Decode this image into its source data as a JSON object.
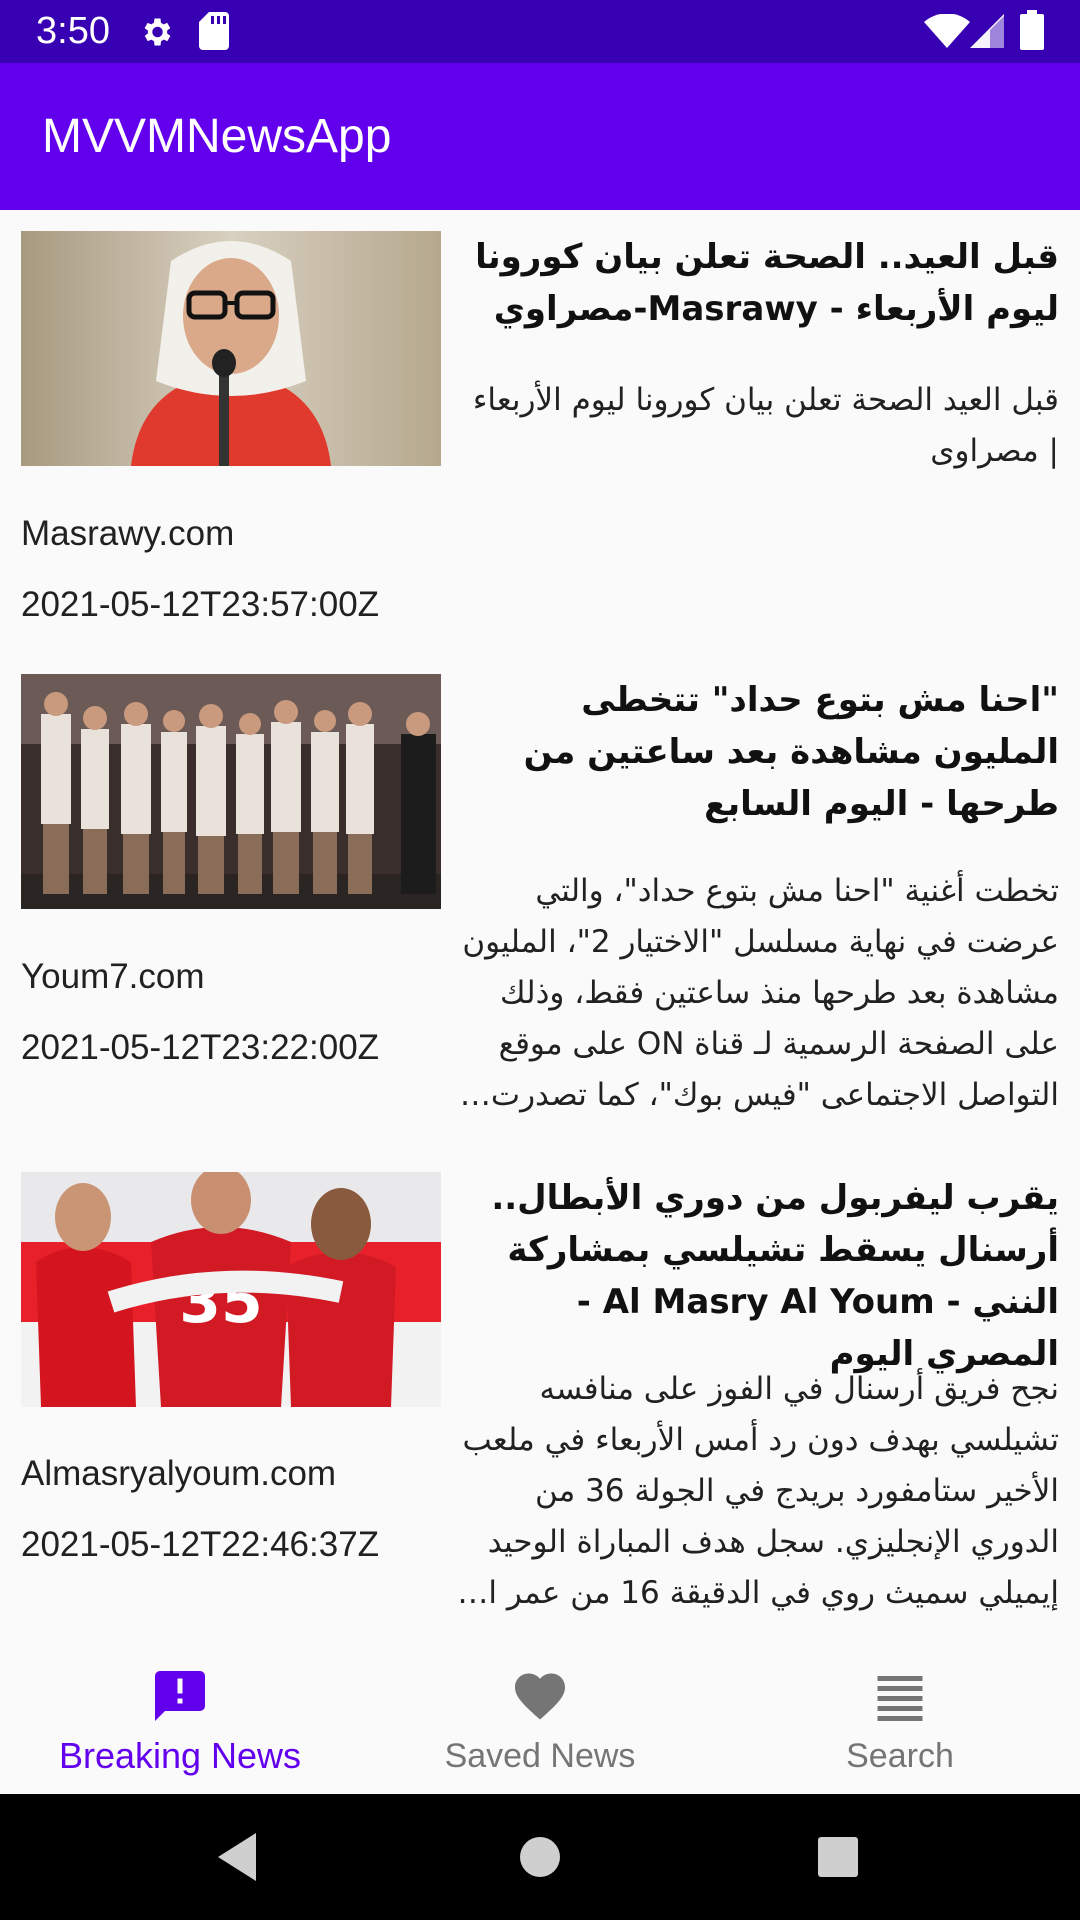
{
  "status_bar": {
    "time": "3:50",
    "icons": [
      "settings-icon",
      "sd-card-icon",
      "wifi-icon",
      "signal-icon",
      "battery-icon"
    ]
  },
  "app_bar": {
    "title": "MVVMNewsApp",
    "color": "#6200ee"
  },
  "articles": [
    {
      "title": "قبل العيد.. الصحة تعلن بيان كورونا ليوم الأربعاء - Masrawy-مصراوي",
      "description": "قبل العيد الصحة تعلن بيان كورونا ليوم الأربعاء | مصراوى",
      "source": "Masrawy.com",
      "published_at": "2021-05-12T23:57:00Z"
    },
    {
      "title": "\"احنا مش بتوع حداد\" تتخطى المليون مشاهدة بعد ساعتين من طرحها - اليوم السابع",
      "description": "تخطت أغنية \"احنا مش بتوع حداد\"، والتي عرضت في نهاية مسلسل \"الاختيار 2\"، المليون مشاهدة بعد طرحها منذ ساعتين فقط، وذلك على الصفحة الرسمية لـ قناة ON على موقع التواصل الاجتماعى \"فيس بوك\"، كما تصدرت…",
      "source": "Youm7.com",
      "published_at": "2021-05-12T23:22:00Z"
    },
    {
      "title": "يقرب ليفربول من دوري الأبطال.. أرسنال يسقط تشيلسي بمشاركة النني - Al Masry Al Youm - المصري اليوم",
      "description": "نجح فريق أرسنال في الفوز على منافسه تشيلسي بهدف دون رد أمس الأربعاء في ملعب الأخير ستامفورد بريدج في الجولة 36 من الدوري الإنجليزي. سجل هدف المباراة الوحيد إيميلي سميث روي في الدقيقة 16 من عمر ا…",
      "source": "Almasryalyoum.com",
      "published_at": "2021-05-12T22:46:37Z"
    }
  ],
  "bottom_nav": {
    "items": [
      {
        "label": "Breaking News",
        "icon": "announcement-icon",
        "active": true
      },
      {
        "label": "Saved News",
        "icon": "heart-icon",
        "active": false
      },
      {
        "label": "Search",
        "icon": "list-icon",
        "active": false
      }
    ],
    "active_color": "#6200ee",
    "inactive_color": "#757575"
  },
  "system_nav": {
    "icons": [
      "back-icon",
      "home-icon",
      "recents-icon"
    ]
  }
}
